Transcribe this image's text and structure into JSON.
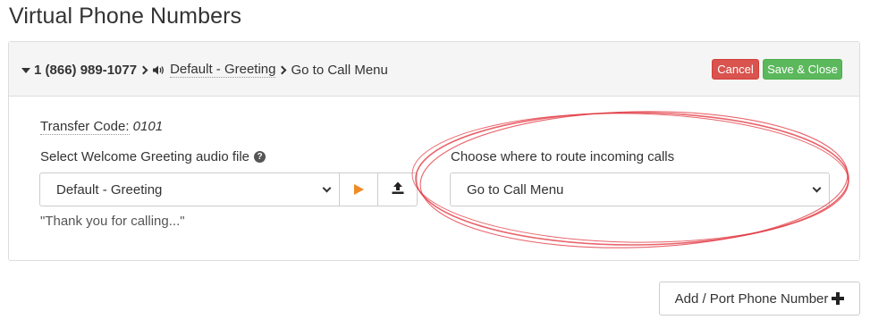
{
  "page": {
    "title": "Virtual Phone Numbers"
  },
  "panel": {
    "breadcrumb": {
      "phone_number": "1 (866) 989-1077",
      "greeting": "Default - Greeting",
      "route": "Go to Call Menu"
    },
    "cancel_label": "Cancel",
    "save_label": "Save & Close",
    "transfer_code_label": "Transfer Code:",
    "transfer_code_value": "0101",
    "greeting_select_label": "Select Welcome Greeting audio file",
    "greeting_select_value": "Default - Greeting",
    "greeting_description": "\"Thank you for calling...\"",
    "route_select_label": "Choose where to route incoming calls",
    "route_select_value": "Go to Call Menu"
  },
  "footer": {
    "add_button_label": "Add / Port Phone Number"
  },
  "icons": {
    "collapse": "caret-down-icon",
    "separator": "chevron-right-icon",
    "audio": "volume-icon",
    "help": "question-circle-icon",
    "play": "play-icon",
    "upload": "upload-icon",
    "dropdown": "chevron-down-icon",
    "add": "plus-icon"
  },
  "colors": {
    "cancel": "#d9534f",
    "save": "#5cb85c",
    "play": "#f08a24",
    "annotation": "#e0303a"
  }
}
